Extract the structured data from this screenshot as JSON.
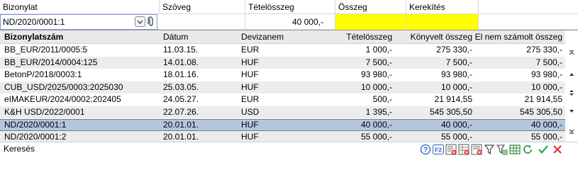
{
  "header": {
    "col_bizonylat": "Bizonylat",
    "col_szoveg": "Szöveg",
    "col_tetelosszeg": "Tételösszeg",
    "col_osszeg": "Összeg",
    "col_kerekites": "Kerekítés"
  },
  "edit_row": {
    "bizonylat_value": "ND/2020/0001:1",
    "szoveg_value": "",
    "tetelosszeg_value": "40 000,-",
    "osszeg_value": "",
    "kerekites_value": "",
    "highlight_color": "#ffff00"
  },
  "popup": {
    "columns": {
      "bizonylatszam": "Bizonylatszám",
      "datum": "Dátum",
      "devizanem": "Devizanem",
      "tetelosszeg": "Tételösszeg",
      "konyvelt": "Könyvelt összeg",
      "el_nem_szamolt": "El nem számolt összeg"
    },
    "rows": [
      {
        "bizonylatszam": "BB_EUR/2011/0005:5",
        "datum": "11.03.15.",
        "devizanem": "EUR",
        "tetelosszeg": "1 000,-",
        "konyvelt": "275 330,-",
        "el_nem_szamolt": "275 330,-"
      },
      {
        "bizonylatszam": "BB_EUR/2014/0004:125",
        "datum": "14.01.08.",
        "devizanem": "HUF",
        "tetelosszeg": "7 500,-",
        "konyvelt": "7 500,-",
        "el_nem_szamolt": "7 500,-"
      },
      {
        "bizonylatszam": "BetonP/2018/0003:1",
        "datum": "18.01.16.",
        "devizanem": "HUF",
        "tetelosszeg": "93 980,-",
        "konyvelt": "93 980,-",
        "el_nem_szamolt": "93 980,-"
      },
      {
        "bizonylatszam": "CUB_USD/2025/0003:2025030",
        "datum": "25.03.05.",
        "devizanem": "HUF",
        "tetelosszeg": "10 000,-",
        "konyvelt": "10 000,-",
        "el_nem_szamolt": "10 000,-"
      },
      {
        "bizonylatszam": "eIMAKEUR/2024/0002:202405",
        "datum": "24.05.27.",
        "devizanem": "EUR",
        "tetelosszeg": "500,-",
        "konyvelt": "21 914,55",
        "el_nem_szamolt": "21 914,55"
      },
      {
        "bizonylatszam": "K&H USD/2022/0001",
        "datum": "22.07.26.",
        "devizanem": "USD",
        "tetelosszeg": "1 395,-",
        "konyvelt": "545 305,50",
        "el_nem_szamolt": "545 305,50"
      },
      {
        "bizonylatszam": "ND/2020/0001:1",
        "datum": "20.01.01.",
        "devizanem": "HUF",
        "tetelosszeg": "40 000,-",
        "konyvelt": "40 000,-",
        "el_nem_szamolt": "40 000,-"
      },
      {
        "bizonylatszam": "ND/2020/0001:2",
        "datum": "20.01.01.",
        "devizanem": "HUF",
        "tetelosszeg": "55 000,-",
        "konyvelt": "55 000,-",
        "el_nem_szamolt": "55 000,-"
      }
    ],
    "selected_row": 6,
    "selection_color": "#b5c5dd"
  },
  "footer": {
    "search_label": "Keresés",
    "icons": [
      "help-icon",
      "f2-icon",
      "cancel-filter-icon",
      "excel-filter-icon",
      "clear-filter-icon",
      "filter-icon",
      "filter-settings-icon",
      "table-view-icon",
      "refresh-icon",
      "ok-check-icon",
      "close-x-icon"
    ]
  }
}
